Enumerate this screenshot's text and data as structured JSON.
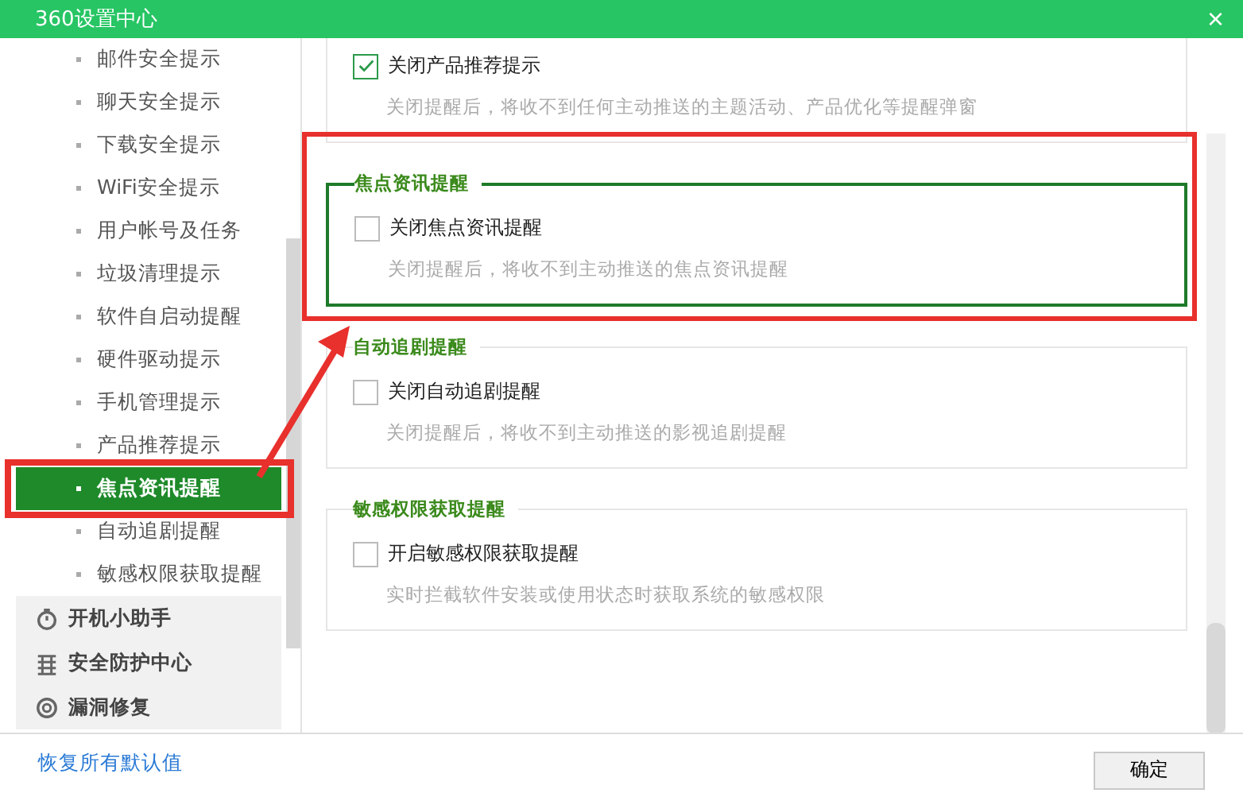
{
  "window": {
    "title": "360设置中心",
    "close": "×"
  },
  "sidebar": {
    "items": [
      {
        "label": "邮件安全提示",
        "selected": false,
        "annotated": false
      },
      {
        "label": "聊天安全提示",
        "selected": false,
        "annotated": false
      },
      {
        "label": "下载安全提示",
        "selected": false,
        "annotated": false
      },
      {
        "label": "WiFi安全提示",
        "selected": false,
        "annotated": false
      },
      {
        "label": "用户帐号及任务",
        "selected": false,
        "annotated": false
      },
      {
        "label": "垃圾清理提示",
        "selected": false,
        "annotated": false
      },
      {
        "label": "软件自启动提醒",
        "selected": false,
        "annotated": false
      },
      {
        "label": "硬件驱动提示",
        "selected": false,
        "annotated": false
      },
      {
        "label": "手机管理提示",
        "selected": false,
        "annotated": false
      },
      {
        "label": "产品推荐提示",
        "selected": false,
        "annotated": false
      },
      {
        "label": "焦点资讯提醒",
        "selected": true,
        "annotated": true
      },
      {
        "label": "自动追剧提醒",
        "selected": false,
        "annotated": false
      },
      {
        "label": "敏感权限获取提醒",
        "selected": false,
        "annotated": false
      }
    ],
    "groups": [
      {
        "label": "开机小助手",
        "kind": "timer"
      },
      {
        "label": "安全防护中心",
        "kind": "shield"
      },
      {
        "label": "漏洞修复",
        "kind": "repair"
      }
    ]
  },
  "sections": [
    {
      "option": "关闭产品推荐提示",
      "checked": true,
      "description": "关闭提醒后，将收不到任何主动推送的主题活动、产品优化等提醒弹窗"
    },
    {
      "title": "焦点资讯提醒",
      "option": "关闭焦点资讯提醒",
      "checked": false,
      "description": "关闭提醒后，将收不到主动推送的焦点资讯提醒",
      "annotated": true
    },
    {
      "title": "自动追剧提醒",
      "option": "关闭自动追剧提醒",
      "checked": false,
      "description": "关闭提醒后，将收不到主动推送的影视追剧提醒"
    },
    {
      "title": "敏感权限获取提醒",
      "option": "开启敏感权限获取提醒",
      "checked": false,
      "description": "实时拦截软件安装或使用状态时获取系统的敏感权限"
    }
  ],
  "footer": {
    "link": "恢复所有默认值",
    "button": "确定"
  }
}
